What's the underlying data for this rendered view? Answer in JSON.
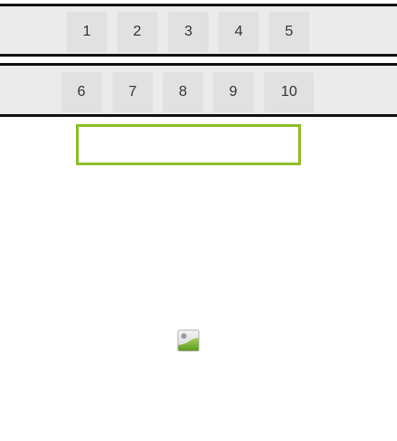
{
  "pager_top": {
    "pages": [
      "1",
      "2",
      "3",
      "4",
      "5"
    ]
  },
  "pager_bottom": {
    "pages": [
      "6",
      "7",
      "8",
      "9",
      "10"
    ]
  },
  "input": {
    "value": "",
    "placeholder": ""
  },
  "image": {
    "icon": "broken-image-icon"
  },
  "colors": {
    "accent": "#8cbd2a",
    "row_background": "#ebebeb",
    "button_background": "#e1e1e1",
    "row_border": "#111111"
  }
}
